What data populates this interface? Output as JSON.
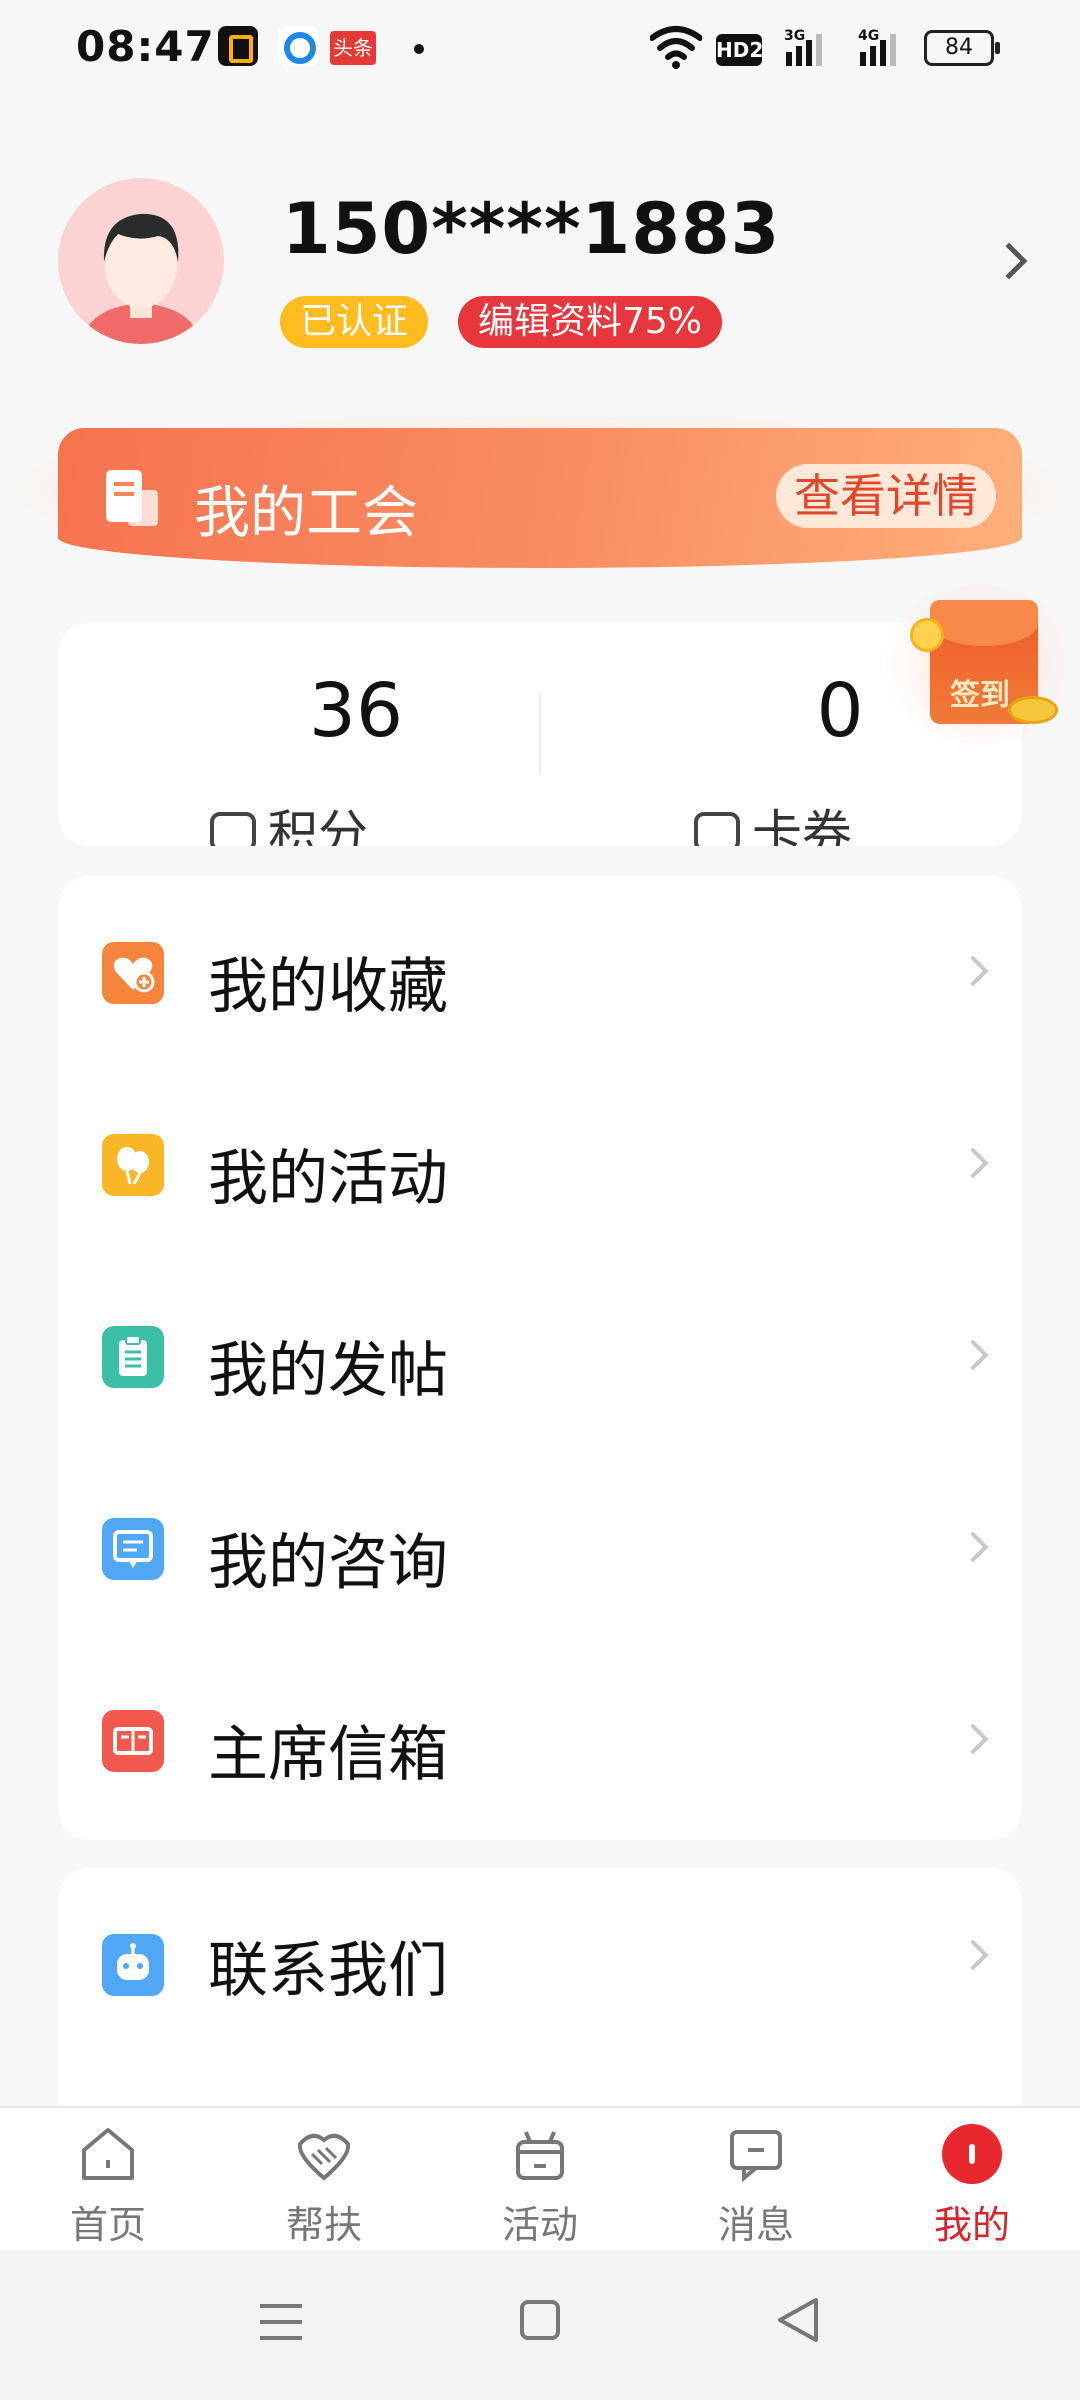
{
  "status_bar": {
    "time": "08:47",
    "notification_icons": [
      "app-icon-1",
      "app-icon-2",
      "toutiao-icon"
    ],
    "toutiao_label": "头条",
    "hd_label": "HD2",
    "network_3g": "3G",
    "network_4g": "4G",
    "battery": "84"
  },
  "profile": {
    "phone": "150****1883",
    "verified_badge": "已认证",
    "edit_badge": "编辑资料75%"
  },
  "union_banner": {
    "title": "我的工会",
    "button": "查看详情"
  },
  "stats": {
    "points_value": "36",
    "points_label": "积分",
    "coupons_value": "0",
    "coupons_label": "卡券"
  },
  "sign_in": {
    "label": "签到"
  },
  "menu": {
    "items": [
      {
        "label": "我的收藏",
        "icon": "heart-favorite-icon",
        "color": "#f5843c"
      },
      {
        "label": "我的活动",
        "icon": "balloon-icon",
        "color": "#f9b727"
      },
      {
        "label": "我的发帖",
        "icon": "clipboard-icon",
        "color": "#3bbfa7"
      },
      {
        "label": "我的咨询",
        "icon": "chat-bubble-icon",
        "color": "#4fa7f5"
      },
      {
        "label": "主席信箱",
        "icon": "mailbox-icon",
        "color": "#f1594f"
      }
    ]
  },
  "contact": {
    "label": "联系我们",
    "icon": "robot-icon",
    "color": "#4fa7f5"
  },
  "tabbar": {
    "items": [
      {
        "label": "首页",
        "icon": "home-icon"
      },
      {
        "label": "帮扶",
        "icon": "handshake-icon"
      },
      {
        "label": "活动",
        "icon": "gift-icon"
      },
      {
        "label": "消息",
        "icon": "message-icon"
      },
      {
        "label": "我的",
        "icon": "profile-icon"
      }
    ],
    "active_index": 4,
    "active_color": "#d8232a"
  }
}
